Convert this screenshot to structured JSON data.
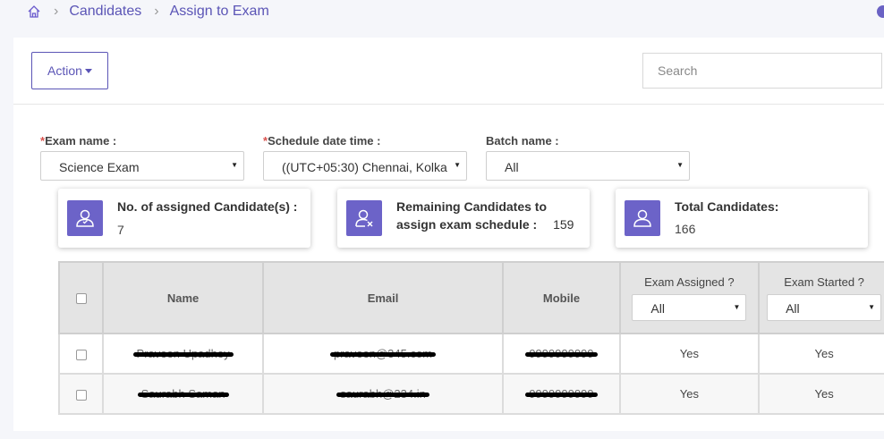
{
  "breadcrumb": {
    "items": [
      "Candidates",
      "Assign to Exam"
    ]
  },
  "toolbar": {
    "action_label": "Action",
    "search_placeholder": "Search"
  },
  "filters": {
    "exam": {
      "label": "Exam name :",
      "required_mark": "*",
      "value": "Science Exam"
    },
    "schedule": {
      "label": "Schedule date time :",
      "required_mark": "*",
      "value": "((UTC+05:30) Chennai, Kolka"
    },
    "batch": {
      "label": "Batch name :",
      "value": "All"
    }
  },
  "stats": {
    "assigned": {
      "title": "No. of assigned Candidate(s) :",
      "value": "7"
    },
    "remaining": {
      "title_line1": "Remaining Candidates to",
      "title_line2": "assign exam schedule :",
      "value": "159"
    },
    "total": {
      "title": "Total Candidates:",
      "value": "166"
    }
  },
  "table": {
    "columns": {
      "name": "Name",
      "email": "Email",
      "mobile": "Mobile",
      "exam_assigned": "Exam Assigned ?",
      "exam_started": "Exam Started ?"
    },
    "filter_values": {
      "exam_assigned": "All",
      "exam_started": "All"
    },
    "rows": [
      {
        "name": "Praveen Upadhey",
        "email": "praveen@345.com",
        "mobile": "9999999999",
        "exam_assigned": "Yes",
        "exam_started": "Yes"
      },
      {
        "name": "Saurabh Saman",
        "email": "saurabh@234.in",
        "mobile": "9999999999",
        "exam_assigned": "Yes",
        "exam_started": "Yes"
      }
    ]
  },
  "colors": {
    "accent": "#5b55b6",
    "icon_bg": "#6c63c8",
    "required": "#d9534f"
  }
}
